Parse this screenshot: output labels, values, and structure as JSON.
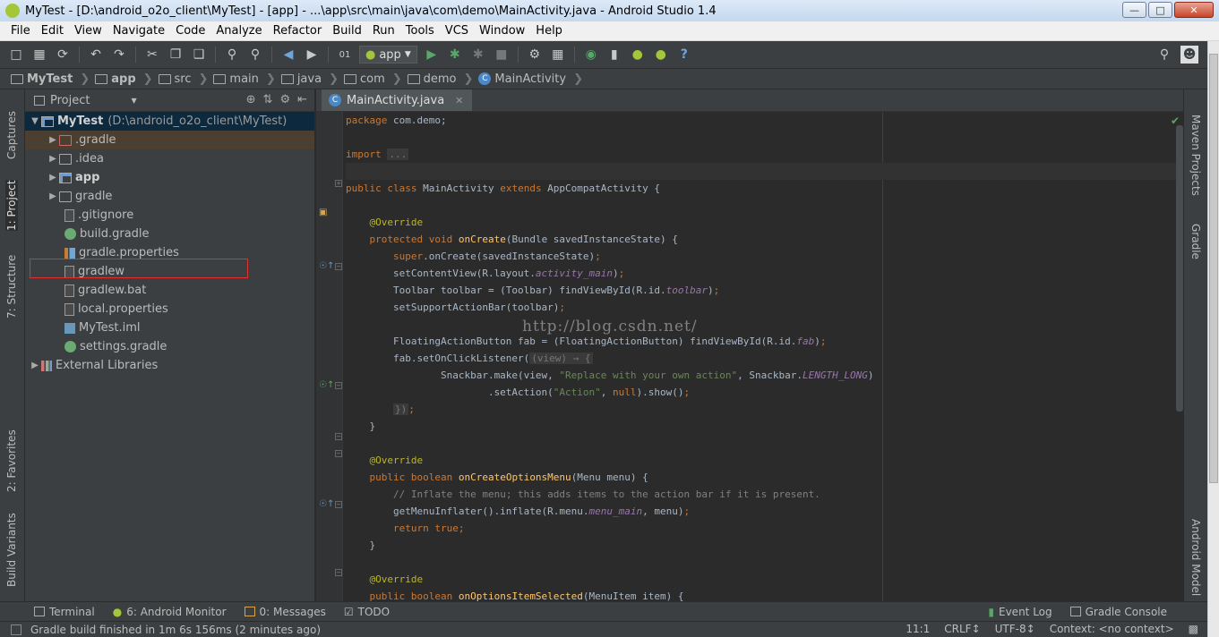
{
  "window": {
    "title": "MyTest - [D:\\android_o2o_client\\MyTest] - [app] - ...\\app\\src\\main\\java\\com\\demo\\MainActivity.java - Android Studio 1.4",
    "minimize": "—",
    "maximize": "□",
    "close": "✕"
  },
  "menu": [
    "File",
    "Edit",
    "View",
    "Navigate",
    "Code",
    "Analyze",
    "Refactor",
    "Build",
    "Run",
    "Tools",
    "VCS",
    "Window",
    "Help"
  ],
  "toolbar": {
    "run_config": "app",
    "help_glyph": "?"
  },
  "breadcrumb": [
    "MyTest",
    "app",
    "src",
    "main",
    "java",
    "com",
    "demo",
    "MainActivity"
  ],
  "left_strip": [
    "1: Project",
    "Captures",
    "7: Structure",
    "2: Favorites",
    "Build Variants"
  ],
  "right_strip": [
    "Maven Projects",
    "Gradle",
    "Android Model"
  ],
  "project_panel": {
    "title": "Project",
    "root": {
      "name": "MyTest",
      "path": "(D:\\android_o2o_client\\MyTest)"
    },
    "items": [
      {
        "label": ".gradle"
      },
      {
        "label": ".idea"
      },
      {
        "label": "app"
      },
      {
        "label": "gradle"
      },
      {
        "label": ".gitignore"
      },
      {
        "label": "build.gradle"
      },
      {
        "label": "gradle.properties"
      },
      {
        "label": "gradlew"
      },
      {
        "label": "gradlew.bat"
      },
      {
        "label": "local.properties"
      },
      {
        "label": "MyTest.iml"
      },
      {
        "label": "settings.gradle"
      },
      {
        "label": "External Libraries"
      }
    ]
  },
  "editor": {
    "tab": "MainActivity.java",
    "watermark": "http://blog.csdn.net/"
  },
  "bottom_tabs": {
    "terminal": "Terminal",
    "android_monitor": "6: Android Monitor",
    "messages": "0: Messages",
    "todo": "TODO",
    "event_log": "Event Log",
    "gradle_console": "Gradle Console"
  },
  "status": {
    "message": "Gradle build finished in 1m 6s 156ms (2 minutes ago)",
    "position": "11:1",
    "line_sep": "CRLF↕",
    "encoding": "UTF-8↕",
    "context": "Context: <no context>"
  },
  "colors": {
    "keyword": "#cc7832",
    "annotation": "#bbb529",
    "method": "#ffc66d",
    "field": "#9876aa",
    "string": "#6a8759",
    "comment": "#808080",
    "highlight_box": "#e03030"
  }
}
